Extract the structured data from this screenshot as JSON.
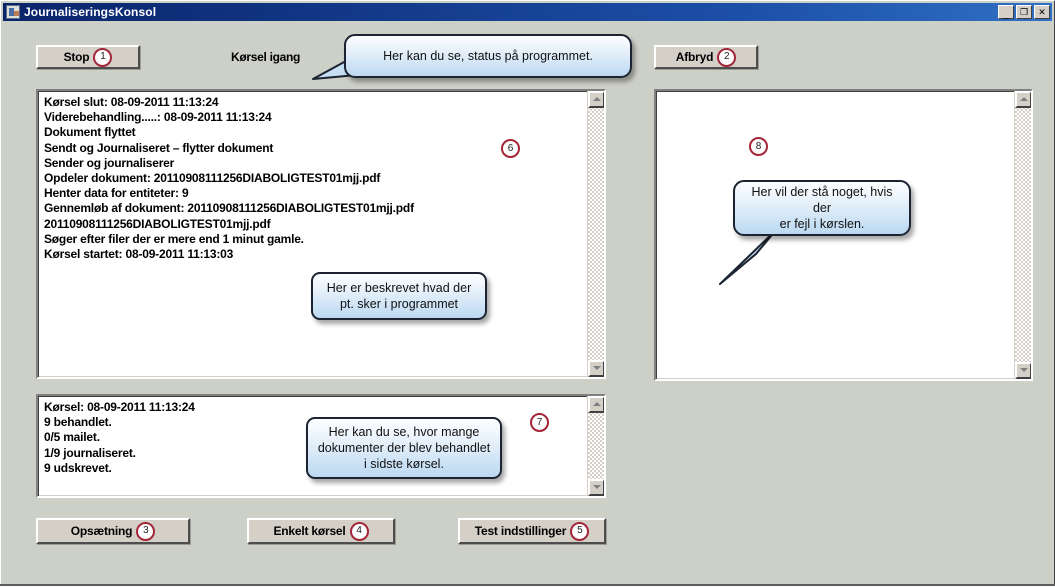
{
  "window": {
    "title": "JournaliseringsKonsol",
    "icon": "app-window-icon",
    "controls": {
      "minimize": "_",
      "maximize": "❐",
      "close": "✕"
    }
  },
  "toolbar": {
    "stop_button": {
      "label": "Stop",
      "badge": "1"
    },
    "abort_button": {
      "label": "Afbryd",
      "badge": "2"
    },
    "status_label": "Kørsel igang"
  },
  "callouts": {
    "status_bubble": "Her kan du se, status på programmet.",
    "log_bubble_line1": "Her er beskrevet hvad der",
    "log_bubble_line2": "pt. sker i programmet",
    "error_bubble_line1": "Her vil der stå noget, hvis der",
    "error_bubble_line2": "er fejl i kørslen.",
    "summary_bubble_line1": "Her kan du se, hvor mange",
    "summary_bubble_line2": "dokumenter der blev behandlet",
    "summary_bubble_line3": "i sidste kørsel."
  },
  "log_panel": {
    "badge": "6",
    "lines": [
      "Kørsel slut: 08-09-2011 11:13:24",
      "Viderebehandling.....: 08-09-2011 11:13:24",
      "Dokument flyttet",
      "Sendt og Journaliseret – flytter dokument",
      "Sender og journaliserer",
      "Opdeler dokument: 20110908111256DIABOLIGTEST01mjj.pdf",
      "Henter data for entiteter: 9",
      "Gennemløb af dokument: 20110908111256DIABOLIGTEST01mjj.pdf",
      "20110908111256DIABOLIGTEST01mjj.pdf",
      "Søger efter filer der er mere end 1 minut gamle.",
      "Kørsel startet: 08-09-2011 11:13:03"
    ]
  },
  "summary_panel": {
    "badge": "7",
    "lines": [
      "Kørsel: 08-09-2011 11:13:24",
      "9 behandlet.",
      "0/5 mailet.",
      "1/9 journaliseret.",
      "9 udskrevet."
    ]
  },
  "error_panel": {
    "badge": "8",
    "lines": []
  },
  "footer_buttons": [
    {
      "label": "Opsætning",
      "badge": "3"
    },
    {
      "label": "Enkelt kørsel",
      "badge": "4"
    },
    {
      "label": "Test indstillinger",
      "badge": "5"
    }
  ],
  "colors": {
    "window_background": "#cdd0c7",
    "title_bar": "#0a246a",
    "button_face": "#d4d0c8",
    "badge_border": "#a32638",
    "panel_background": "#ffffff",
    "callout_fill": "#bcd9f1"
  }
}
